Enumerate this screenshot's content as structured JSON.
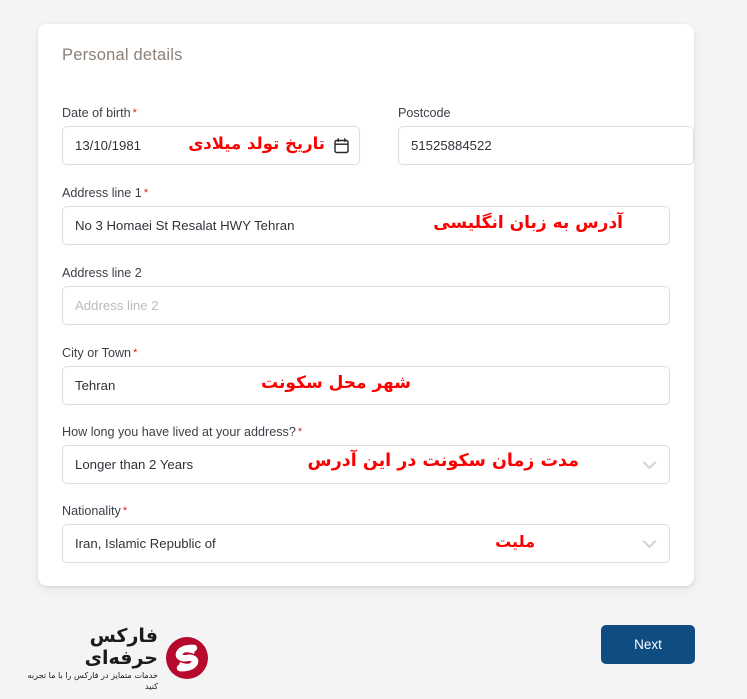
{
  "card": {
    "title": "Personal details"
  },
  "fields": {
    "dob": {
      "label": "Date of birth",
      "required": "*",
      "value": "13/10/1981",
      "annotation_fa": "تاریخ تولد میلادی",
      "icon": "calendar-icon"
    },
    "postcode": {
      "label": "Postcode",
      "required": "",
      "value": "51525884522"
    },
    "address1": {
      "label": "Address line 1",
      "required": "*",
      "value": "No 3 Homaei St Resalat HWY Tehran",
      "annotation_fa": "آدرس به زبان انگلیسی"
    },
    "address2": {
      "label": "Address line 2",
      "required": "",
      "value": "",
      "placeholder": "Address line 2"
    },
    "city": {
      "label": "City or Town",
      "required": "*",
      "value": "Tehran",
      "annotation_fa": "شهر محل سکونت"
    },
    "duration": {
      "label": "How long you have lived at your address?",
      "required": "*",
      "value": "Longer than 2 Years",
      "annotation_fa": "مدت زمان سکونت در این آدرس",
      "icon": "chevron-down-icon"
    },
    "nationality": {
      "label": "Nationality",
      "required": "*",
      "value": "Iran, Islamic Republic of",
      "annotation_fa": "ملیت",
      "icon": "chevron-down-icon"
    }
  },
  "footer": {
    "next_label": "Next",
    "brand_name": "فارکس حرفه‌ای",
    "brand_tagline": "خدمات متمایز در فارکس را با ما تجربه کنید"
  },
  "colors": {
    "page_background": "#f4f4f5",
    "card_background": "#ffffff",
    "title": "#8c8178",
    "label": "#3b4149",
    "annotation_red": "#fb0000",
    "required_red": "#e02020",
    "input_border": "#dcdee1",
    "placeholder": "#b9bcc0",
    "next_button": "#0f4c81",
    "brand_mark": "#b5092d"
  }
}
